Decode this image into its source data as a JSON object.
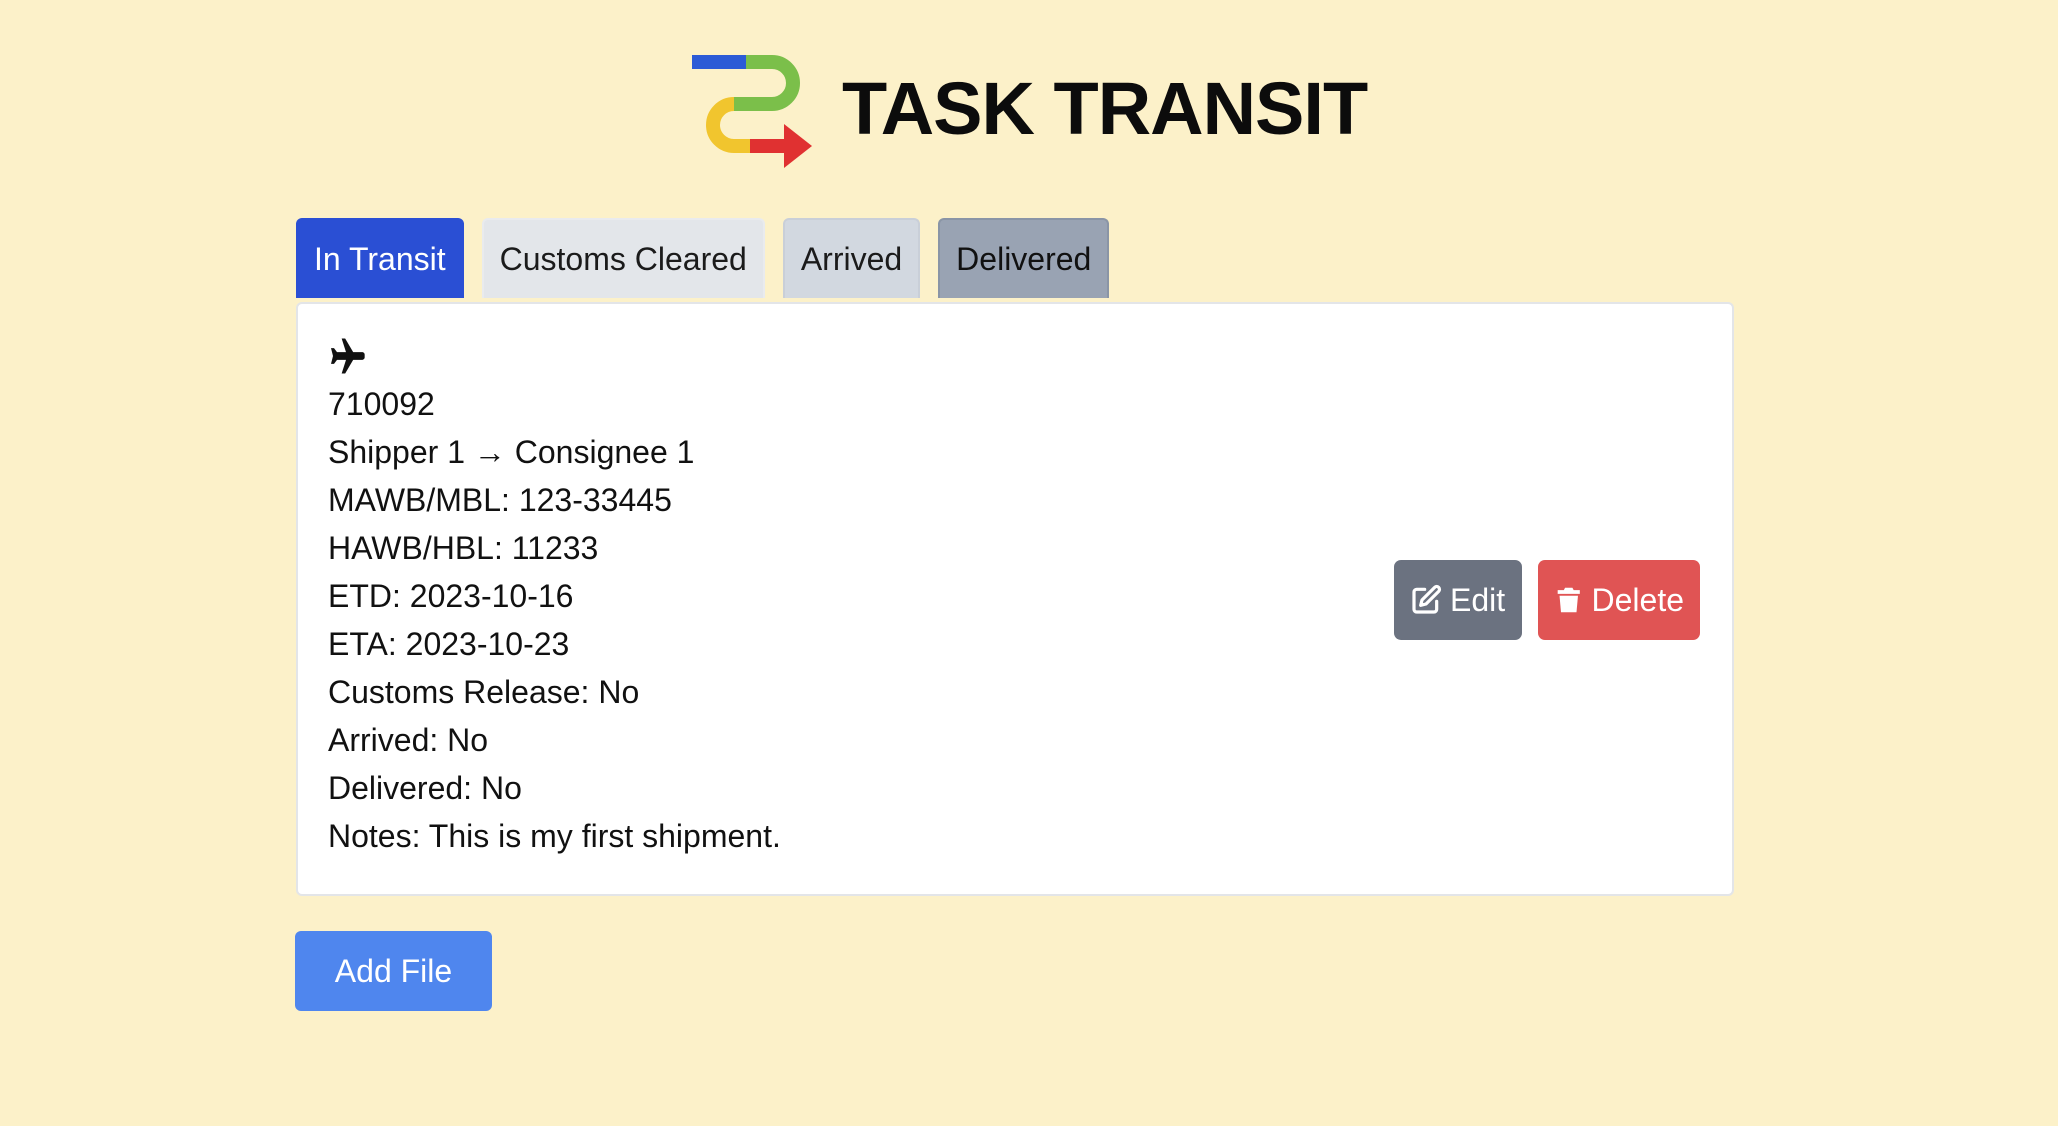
{
  "app": {
    "title": "TASK TRANSIT",
    "logo_icon": "route-arrow-logo-icon"
  },
  "tabs": [
    {
      "label": "In Transit",
      "active": true,
      "color": "#2a4fd4"
    },
    {
      "label": "Customs Cleared",
      "active": false,
      "color": "#e3e6ea"
    },
    {
      "label": "Arrived",
      "active": false,
      "color": "#d2d8e0"
    },
    {
      "label": "Delivered",
      "active": false,
      "color": "#99a3b3"
    }
  ],
  "shipment": {
    "mode_icon": "airplane-icon",
    "file_number": "710092",
    "route": "Shipper 1 → Consignee 1",
    "mawb": "MAWB/MBL: 123-33445",
    "hawb": "HAWB/HBL: 11233",
    "etd": "ETD: 2023-10-16",
    "eta": "ETA: 2023-10-23",
    "customs_release": "Customs Release: No",
    "arrived": "Arrived: No",
    "delivered": "Delivered: No",
    "notes": "Notes: This is my first shipment."
  },
  "actions": {
    "edit_label": "Edit",
    "edit_icon": "edit-icon",
    "delete_label": "Delete",
    "delete_icon": "trash-icon"
  },
  "add_file_label": "Add File",
  "colors": {
    "background": "#fcf1c9",
    "primary": "#2a4fd4",
    "add_button": "#4f86ee",
    "edit_button": "#6b7280",
    "delete_button": "#e05454"
  }
}
